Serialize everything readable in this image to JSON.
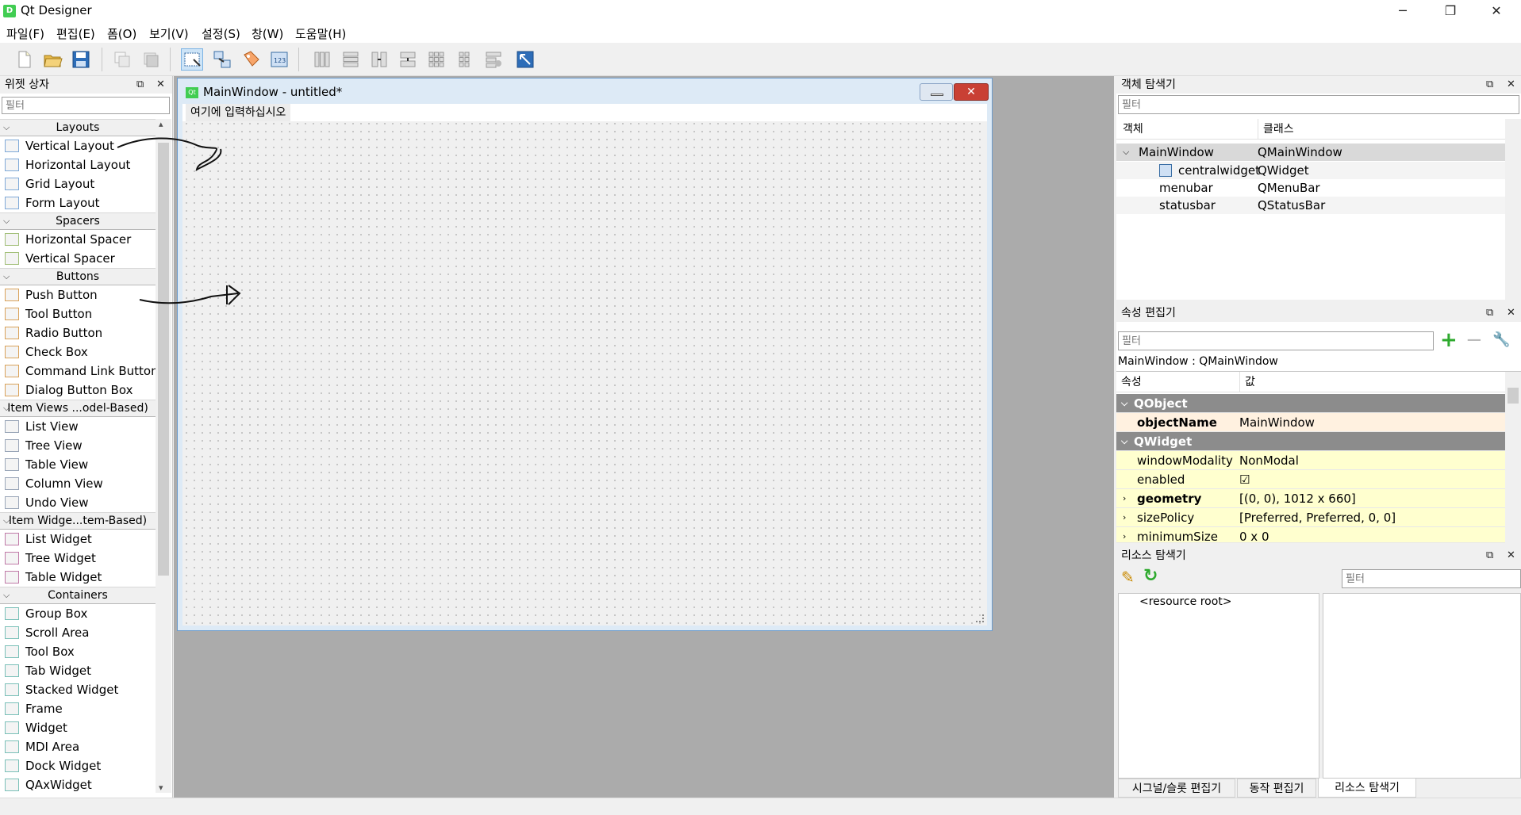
{
  "window": {
    "title": "Qt Designer",
    "icon": "D",
    "minimize": "─",
    "maximize": "❐",
    "close": "✕"
  },
  "menu": [
    "파일(F)",
    "편집(E)",
    "폼(O)",
    "보기(V)",
    "설정(S)",
    "창(W)",
    "도움말(H)"
  ],
  "widget_box": {
    "title": "위젯 상자",
    "filter_placeholder": "필터",
    "categories": [
      {
        "label": "Layouts",
        "items": [
          "Vertical Layout",
          "Horizontal Layout",
          "Grid Layout",
          "Form Layout"
        ]
      },
      {
        "label": "Spacers",
        "items": [
          "Horizontal Spacer",
          "Vertical Spacer"
        ]
      },
      {
        "label": "Buttons",
        "items": [
          "Push Button",
          "Tool Button",
          "Radio Button",
          "Check Box",
          "Command Link Button",
          "Dialog Button Box"
        ]
      },
      {
        "label": "Item Views ...odel-Based)",
        "items": [
          "List View",
          "Tree View",
          "Table View",
          "Column View",
          "Undo View"
        ]
      },
      {
        "label": "Item Widge...tem-Based)",
        "items": [
          "List Widget",
          "Tree Widget",
          "Table Widget"
        ]
      },
      {
        "label": "Containers",
        "items": [
          "Group Box",
          "Scroll Area",
          "Tool Box",
          "Tab Widget",
          "Stacked Widget",
          "Frame",
          "Widget",
          "MDI Area",
          "Dock Widget",
          "QAxWidget"
        ]
      }
    ]
  },
  "form": {
    "title": "MainWindow - untitled*",
    "qt_badge": "Qt",
    "menu_placeholder": "여기에 입력하십시오",
    "close": "✕"
  },
  "object_inspector": {
    "title": "객체 탐색기",
    "filter_placeholder": "필터",
    "col_object": "객체",
    "col_class": "클래스",
    "rows": [
      {
        "object": "MainWindow",
        "class": "QMainWindow"
      },
      {
        "object": "centralwidget",
        "class": "QWidget"
      },
      {
        "object": "menubar",
        "class": "QMenuBar"
      },
      {
        "object": "statusbar",
        "class": "QStatusBar"
      }
    ]
  },
  "property_editor": {
    "title": "속성 편집기",
    "filter_placeholder": "필터",
    "context": "MainWindow : QMainWindow",
    "col_property": "속성",
    "col_value": "값",
    "groups": [
      {
        "name": "QObject",
        "props": [
          {
            "name": "objectName",
            "value": "MainWindow",
            "bold": true
          }
        ]
      },
      {
        "name": "QWidget",
        "props": [
          {
            "name": "windowModality",
            "value": "NonModal"
          },
          {
            "name": "enabled",
            "value": "☑"
          },
          {
            "name": "geometry",
            "value": "[(0, 0), 1012 x 660]",
            "bold": true
          },
          {
            "name": "sizePolicy",
            "value": "[Preferred, Preferred, 0, 0]"
          },
          {
            "name": "minimumSize",
            "value": "0 x 0"
          }
        ]
      }
    ]
  },
  "resource_browser": {
    "title": "리소스 탐색기",
    "filter_placeholder": "필터",
    "root": "<resource root>"
  },
  "bottom_tabs": [
    "시그널/슬롯 편집기",
    "동작 편집기",
    "리소스 탐색기"
  ],
  "colors": {
    "accent": "#41cd52",
    "form_border": "#6b9acb",
    "close_red": "#c94034",
    "prop_group": "#8c8c8c",
    "prop_bold_row": "#fff1e0",
    "prop_row": "#ffffcf"
  }
}
